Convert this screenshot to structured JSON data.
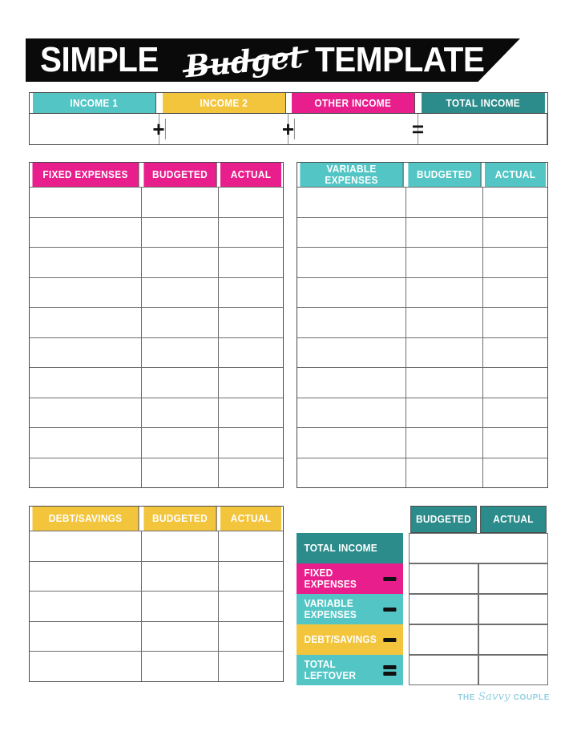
{
  "document": {
    "title_word1": "SIMPLE",
    "title_script": "Budget",
    "title_word2": "TEMPLATE"
  },
  "colors": {
    "teal_light": "#54c5c5",
    "teal_dark": "#2c8b8b",
    "magenta": "#e81e8c",
    "yellow": "#f2c53d",
    "black": "#0a0a0a",
    "logo_blue": "#93cfe0",
    "border": "#4a4a4a"
  },
  "income_section": {
    "columns": [
      {
        "label": "INCOME 1",
        "color": "#54c5c5"
      },
      {
        "label": "INCOME 2",
        "color": "#f2c53d"
      },
      {
        "label": "OTHER INCOME",
        "color": "#e81e8c"
      },
      {
        "label": "TOTAL INCOME",
        "color": "#2c8b8b"
      }
    ],
    "operators": [
      "+",
      "+",
      "="
    ],
    "value_row": [
      "",
      "",
      "",
      ""
    ]
  },
  "fixed_expenses": {
    "headers": [
      "FIXED EXPENSES",
      "BUDGETED",
      "ACTUAL"
    ],
    "header_color": "#e81e8c",
    "row_count": 10,
    "rows": [
      [
        "",
        "",
        ""
      ],
      [
        "",
        "",
        ""
      ],
      [
        "",
        "",
        ""
      ],
      [
        "",
        "",
        ""
      ],
      [
        "",
        "",
        ""
      ],
      [
        "",
        "",
        ""
      ],
      [
        "",
        "",
        ""
      ],
      [
        "",
        "",
        ""
      ],
      [
        "",
        "",
        ""
      ],
      [
        "",
        "",
        ""
      ]
    ]
  },
  "variable_expenses": {
    "headers": [
      "VARIABLE EXPENSES",
      "BUDGETED",
      "ACTUAL"
    ],
    "header_color": "#54c5c5",
    "row_count": 10,
    "rows": [
      [
        "",
        "",
        ""
      ],
      [
        "",
        "",
        ""
      ],
      [
        "",
        "",
        ""
      ],
      [
        "",
        "",
        ""
      ],
      [
        "",
        "",
        ""
      ],
      [
        "",
        "",
        ""
      ],
      [
        "",
        "",
        ""
      ],
      [
        "",
        "",
        ""
      ],
      [
        "",
        "",
        ""
      ],
      [
        "",
        "",
        ""
      ]
    ]
  },
  "debt_savings": {
    "headers": [
      "DEBT/SAVINGS",
      "BUDGETED",
      "ACTUAL"
    ],
    "header_color": "#f2c53d",
    "row_count": 5,
    "rows": [
      [
        "",
        "",
        ""
      ],
      [
        "",
        "",
        ""
      ],
      [
        "",
        "",
        ""
      ],
      [
        "",
        "",
        ""
      ],
      [
        "",
        "",
        ""
      ]
    ]
  },
  "summary": {
    "headers": [
      "BUDGETED",
      "ACTUAL"
    ],
    "header_color": "#2c8b8b",
    "rows": [
      {
        "label": "TOTAL INCOME",
        "color": "#2c8b8b",
        "operator": "none",
        "merged": true,
        "budgeted": "",
        "actual": ""
      },
      {
        "label": "FIXED EXPENSES",
        "color": "#e81e8c",
        "operator": "minus",
        "merged": false,
        "budgeted": "",
        "actual": ""
      },
      {
        "label": "VARIABLE EXPENSES",
        "color": "#54c5c5",
        "operator": "minus",
        "merged": false,
        "budgeted": "",
        "actual": ""
      },
      {
        "label": "DEBT/SAVINGS",
        "color": "#f2c53d",
        "operator": "minus",
        "merged": false,
        "budgeted": "",
        "actual": ""
      },
      {
        "label": "TOTAL LEFTOVER",
        "color": "#54c5c5",
        "operator": "equals",
        "merged": false,
        "budgeted": "",
        "actual": ""
      }
    ]
  },
  "footer": {
    "brand_the": "THE",
    "brand_script": "Savvy",
    "brand_couple": "COUPLE"
  }
}
